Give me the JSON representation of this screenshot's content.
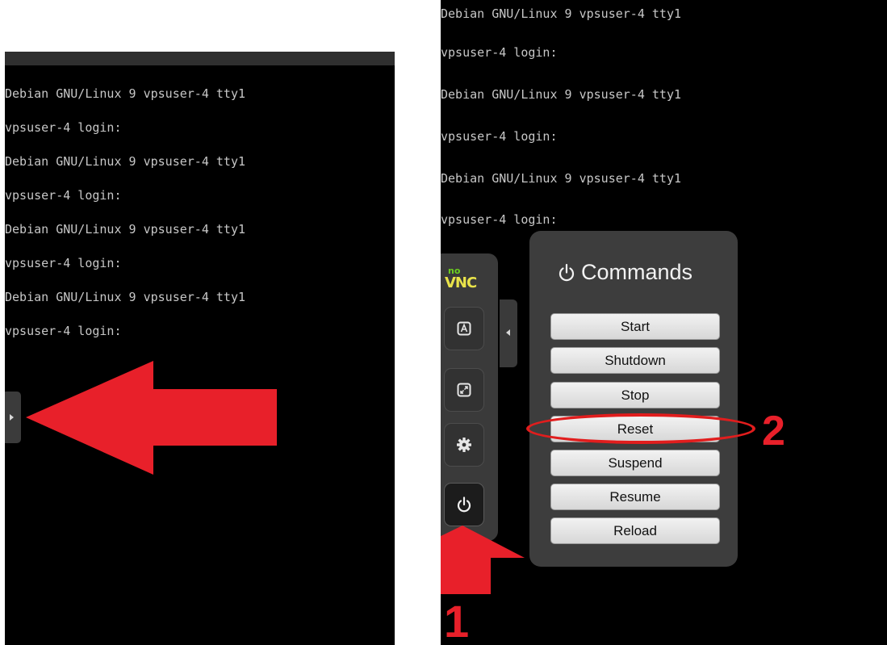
{
  "left_terminal": {
    "lines": [
      "Debian GNU/Linux 9 vpsuser-4 tty1",
      "vpsuser-4 login:",
      "Debian GNU/Linux 9 vpsuser-4 tty1",
      "vpsuser-4 login:",
      "Debian GNU/Linux 9 vpsuser-4 tty1",
      "vpsuser-4 login:",
      "Debian GNU/Linux 9 vpsuser-4 tty1",
      "vpsuser-4 login:"
    ]
  },
  "right_terminal": {
    "lines": [
      "Debian GNU/Linux 9 vpsuser-4 tty1",
      "vpsuser-4 login:",
      "Debian GNU/Linux 9 vpsuser-4 tty1",
      "vpsuser-4 login:",
      "Debian GNU/Linux 9 vpsuser-4 tty1",
      "vpsuser-4 login:"
    ]
  },
  "novnc_logo": {
    "top": "no",
    "bottom": "VNC"
  },
  "commands": {
    "title": "Commands",
    "buttons": [
      "Start",
      "Shutdown",
      "Stop",
      "Reset",
      "Suspend",
      "Resume",
      "Reload"
    ]
  },
  "annotations": {
    "step1": "1",
    "step2": "2",
    "color": "#e8202a"
  }
}
